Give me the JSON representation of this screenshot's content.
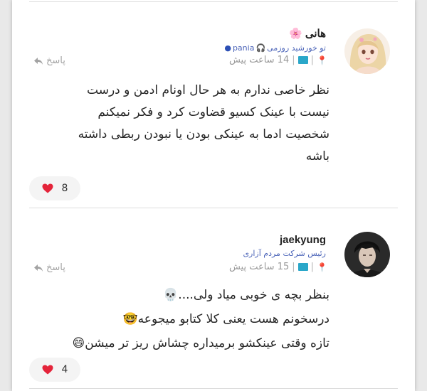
{
  "colors": {
    "accent_blue": "#4a63b8",
    "flag_teal": "#2aa7c9",
    "heart_red": "#e4243a",
    "text_main": "#262626",
    "text_muted": "#9a9a9a"
  },
  "comments": [
    {
      "author": "هانی",
      "author_emoji": "🌸",
      "subtitle_text": "تو خورشید روزمی",
      "subtitle_user": "pania",
      "meta_time": "14 ساعت پیش",
      "reply_label": "پاسخ",
      "body": "نظر خاصی ندارم به هر حال اونام ادمن و درست\nنیست با عینک کسیو قضاوت کرد و فکر نمیکنم\nشخصیت ادما به عینکی بودن یا نبودن ربطی داشته\nباشه",
      "likes": "8"
    },
    {
      "author": "jaekyung",
      "subtitle_text": "رئیس شرکت مردم آزاری",
      "meta_time": "15 ساعت پیش",
      "reply_label": "پاسخ",
      "body": "بنظر بچه ی خوبی میاد ولی....💀\nدرسخونم هست یعنی کلا کتابو میجوعه🤓\nتازه وقتی عینکشو برمیداره چشاش ریز تر میشن😄",
      "likes": "4"
    }
  ]
}
